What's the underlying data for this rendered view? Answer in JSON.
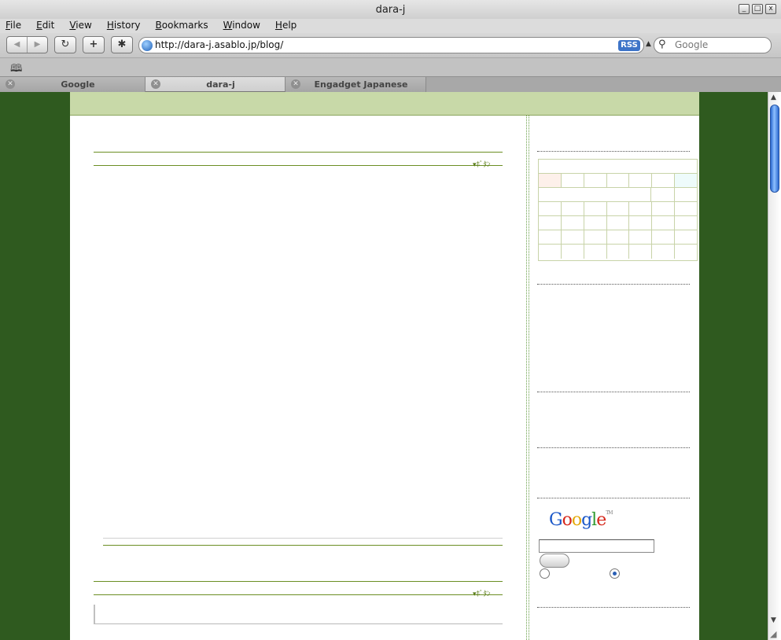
{
  "window": {
    "title": "dara-j",
    "controls": {
      "minimize": "_",
      "maximize": "□",
      "close": "x"
    }
  },
  "menu": [
    "File",
    "Edit",
    "View",
    "History",
    "Bookmarks",
    "Window",
    "Help"
  ],
  "toolbar": {
    "back_icon": "◀",
    "forward_icon": "▶",
    "reload_icon": "↻",
    "add_icon": "+",
    "bug_icon": "✱",
    "url": "http://dara-j.asablo.jp/blog/",
    "rss_label": "RSS",
    "search_placeholder": "Google",
    "search_icon": "⚲"
  },
  "bookmarks": {
    "book_icon": "🕮"
  },
  "tabs": [
    {
      "label": "Google",
      "active": false
    },
    {
      "label": "dara-j",
      "active": true
    },
    {
      "label": "Engadget Japanese",
      "active": false
    }
  ],
  "page": {
    "more_link_1": "▾ﾎﾞﾀﾝ",
    "more_link_2": "▾ﾎﾞﾀﾝ",
    "sidebar": {
      "google_logo": {
        "letters": [
          "G",
          "o",
          "o",
          "g",
          "l",
          "e"
        ],
        "tm": "TM"
      },
      "arrow": "→"
    }
  },
  "colors": {
    "background_green": "#2f5a1f",
    "header_band": "#c8d9a8",
    "rule_green": "#6b8e23",
    "google_blue": "#1a57c8",
    "google_red": "#d6261a",
    "google_yellow": "#e4a90b",
    "google_green": "#2f9a2f"
  }
}
